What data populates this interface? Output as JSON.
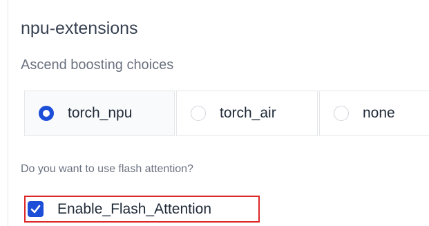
{
  "section": {
    "title": "npu-extensions"
  },
  "boosting": {
    "label": "Ascend boosting choices",
    "options": [
      {
        "label": "torch_npu",
        "selected": true
      },
      {
        "label": "torch_air",
        "selected": false
      },
      {
        "label": "none",
        "selected": false
      }
    ]
  },
  "flash_attention": {
    "question": "Do you want to use flash attention?",
    "checkbox_label": "Enable_Flash_Attention",
    "checked": true,
    "highlight_color": "#dc2626"
  },
  "colors": {
    "accent": "#1d4ed8",
    "highlight": "#dc2626"
  }
}
